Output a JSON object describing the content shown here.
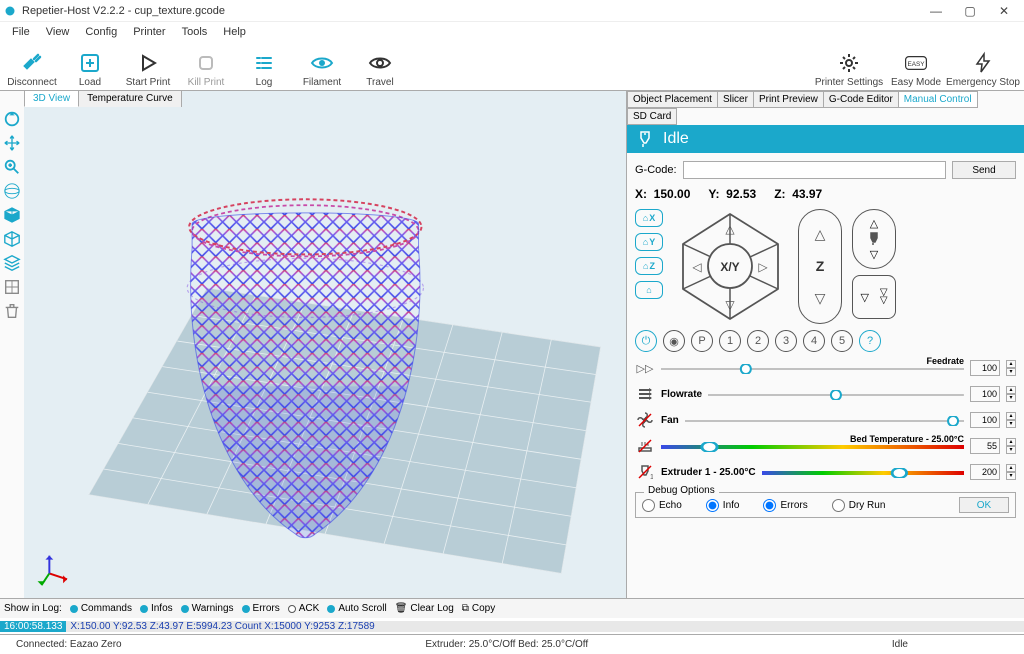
{
  "titlebar": {
    "title": "Repetier-Host V2.2.2 - cup_texture.gcode"
  },
  "menu": {
    "items": [
      "File",
      "View",
      "Config",
      "Printer",
      "Tools",
      "Help"
    ]
  },
  "toolbar": {
    "disconnect": "Disconnect",
    "load": "Load",
    "start": "Start Print",
    "kill": "Kill Print",
    "log": "Log",
    "filament": "Filament",
    "travel": "Travel",
    "printer_settings": "Printer Settings",
    "easy": "Easy Mode",
    "emergency": "Emergency Stop"
  },
  "left_tabs": {
    "view3d": "3D View",
    "temp": "Temperature Curve"
  },
  "right_tabs": {
    "obj": "Object Placement",
    "slicer": "Slicer",
    "preview": "Print Preview",
    "gcode": "G-Code Editor",
    "manual": "Manual Control",
    "sd": "SD Card"
  },
  "status": {
    "state": "Idle"
  },
  "gcode_row": {
    "label": "G-Code:",
    "send": "Send",
    "value": ""
  },
  "coords": {
    "x_lbl": "X:",
    "x": "150.00",
    "y_lbl": "Y:",
    "y": "92.53",
    "z_lbl": "Z:",
    "z": "43.97"
  },
  "home": {
    "x": "X",
    "y": "Y",
    "z": "Z"
  },
  "jog": {
    "xy": "X/Y",
    "z": "Z"
  },
  "circles": {
    "p": "P",
    "n1": "1",
    "n2": "2",
    "n3": "3",
    "n4": "4",
    "n5": "5",
    "q": "?"
  },
  "sliders": {
    "feedrate": {
      "label": "Feedrate",
      "value": "100"
    },
    "flowrate": {
      "label": "Flowrate",
      "value": "100"
    },
    "fan": {
      "label": "Fan",
      "value": "100"
    },
    "bed": {
      "label": "Bed Temperature - 25.00°C",
      "value": "55"
    },
    "ext": {
      "label": "Extruder 1 - 25.00°C",
      "value": "200"
    }
  },
  "debug": {
    "legend": "Debug Options",
    "echo": "Echo",
    "info": "Info",
    "errors": "Errors",
    "dryrun": "Dry Run",
    "ok": "OK"
  },
  "logbar": {
    "showin": "Show in Log:",
    "commands": "Commands",
    "infos": "Infos",
    "warnings": "Warnings",
    "errors": "Errors",
    "ack": "ACK",
    "autoscroll": "Auto Scroll",
    "clear": "Clear Log",
    "copy": "Copy"
  },
  "logline": {
    "ts": "16:00:58.133",
    "msg": "X:150.00 Y:92.53 Z:43.97 E:5994.23 Count X:15000 Y:9253 Z:17589"
  },
  "statusbar": {
    "conn": "Connected: Eazao Zero",
    "ext": "Extruder: 25.0°C/Off Bed: 25.0°C/Off",
    "idle": "Idle"
  }
}
